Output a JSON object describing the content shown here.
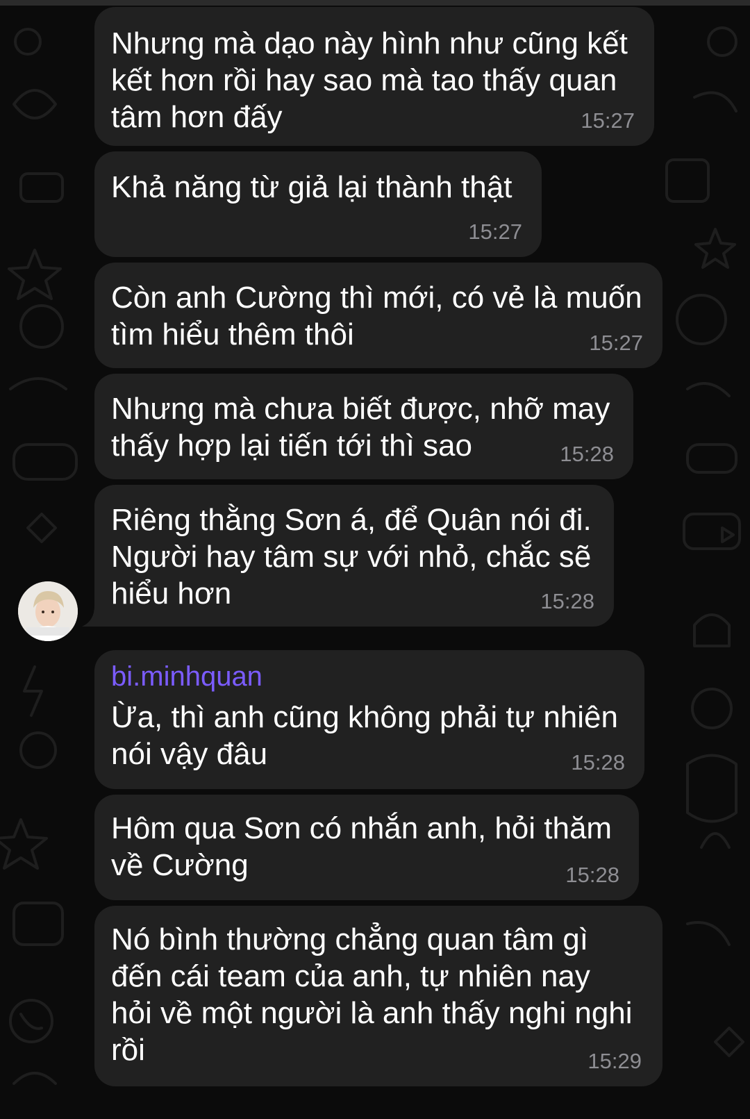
{
  "messages": [
    {
      "text": "Nhưng mà dạo này hình như cũng kết\nkết hơn rồi hay sao mà tao thấy quan\ntâm hơn đấy",
      "time": "15:27"
    },
    {
      "text": "Khả năng từ giả lại thành thật",
      "time": "15:27"
    },
    {
      "text": "Còn anh Cường thì mới, có vẻ là muốn\ntìm hiểu thêm thôi",
      "time": "15:27"
    },
    {
      "text": "Nhưng mà chưa biết được, nhỡ may\nthấy hợp lại tiến tới thì sao",
      "time": "15:28"
    },
    {
      "text": "Riêng thằng Sơn á, để Quân nói đi.\nNgười hay tâm sự với nhỏ, chắc sẽ\nhiểu hơn",
      "time": "15:28"
    },
    {
      "sender": "bi.minhquan",
      "text": "Ừa, thì anh cũng không phải tự nhiên\nnói vậy đâu",
      "time": "15:28"
    },
    {
      "text": "Hôm qua Sơn có nhắn anh, hỏi thăm\nvề Cường",
      "time": "15:28"
    },
    {
      "text": "Nó bình thường chẳng quan tâm gì\nđến cái team của anh, tự nhiên nay\nhỏi về một người là anh thấy nghi nghi\nrồi",
      "time": "15:29"
    }
  ],
  "colors": {
    "background": "#0b0b0b",
    "bubble": "#212121",
    "text": "#ffffff",
    "time": "#8e8e93",
    "sender": "#7b5cff"
  },
  "icons": [
    "avatar-photo"
  ]
}
